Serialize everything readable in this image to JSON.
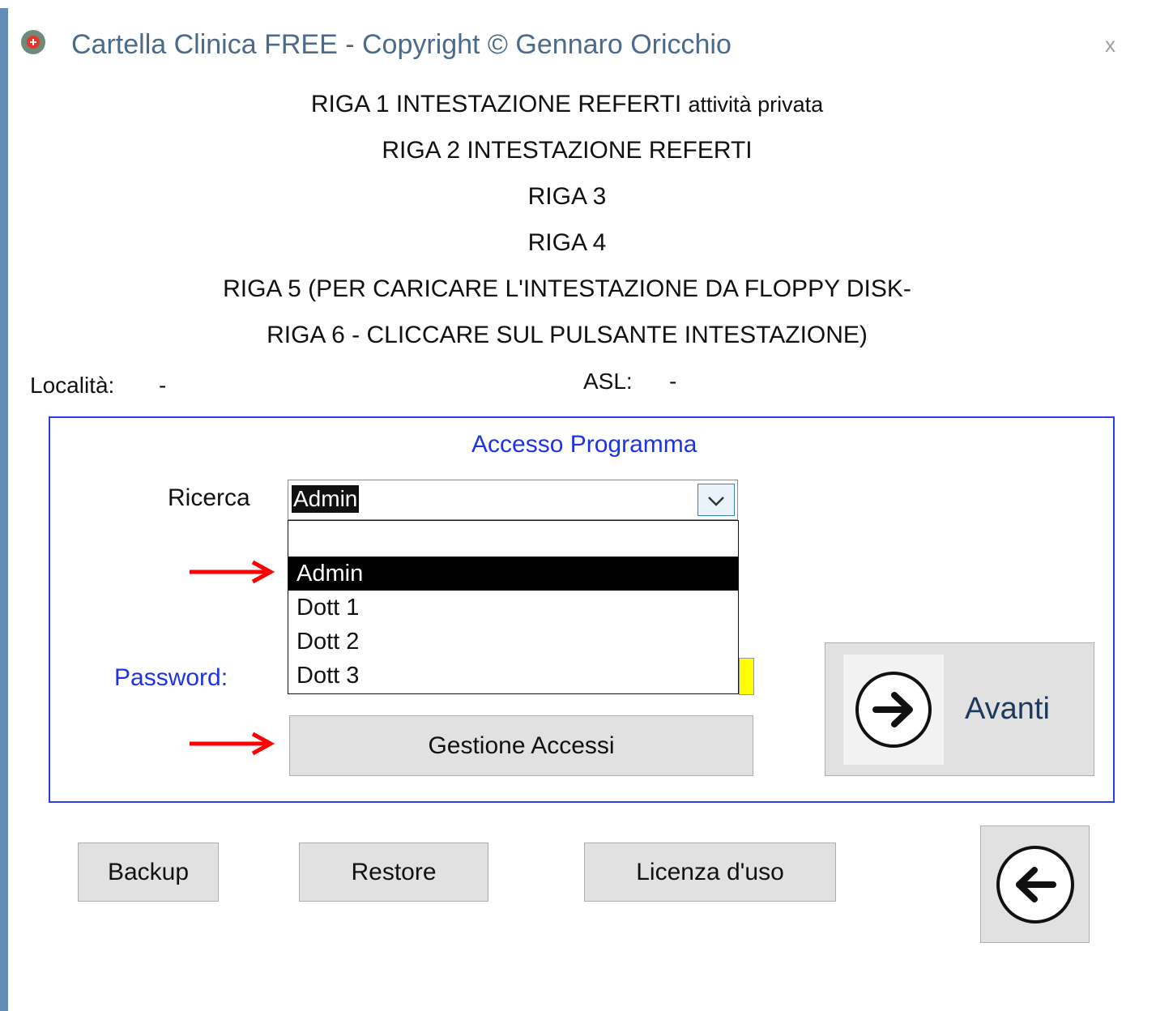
{
  "window": {
    "title": "Cartella Clinica FREE - Copyright © Gennaro Oricchio",
    "close_glyph": "x",
    "app_icon": "medical-cross-icon"
  },
  "header": {
    "line1_main": "RIGA 1 INTESTAZIONE REFERTI",
    "line1_small": "attività privata",
    "line2": "RIGA 2 INTESTAZIONE REFERTI",
    "line3": "RIGA 3",
    "line4": "RIGA 4",
    "line5": "RIGA 5 (PER CARICARE L'INTESTAZIONE DA FLOPPY DISK-",
    "line6": "RIGA 6 - CLICCARE SUL PULSANTE  INTESTAZIONE)"
  },
  "info": {
    "localita_label": "Località:",
    "localita_value": "-",
    "asl_label": "ASL:",
    "asl_value": "-"
  },
  "access": {
    "group_title": "Accesso Programma",
    "ricerca_label": "Ricerca",
    "ricerca_value": "Admin",
    "dropdown_options": [
      "",
      "Admin",
      "Dott 1",
      "Dott 2",
      "Dott 3"
    ],
    "selected_option": "Admin",
    "password_label": "Password:",
    "gestione_label": "Gestione Accessi",
    "avanti_label": "Avanti"
  },
  "footer": {
    "backup_label": "Backup",
    "restore_label": "Restore",
    "licenza_label": "Licenza d'uso"
  },
  "colors": {
    "accent_blue": "#1f33e6",
    "password_field": "#ffff00",
    "annotation_arrow": "#ff0000",
    "button_face": "#e1e1e1"
  }
}
